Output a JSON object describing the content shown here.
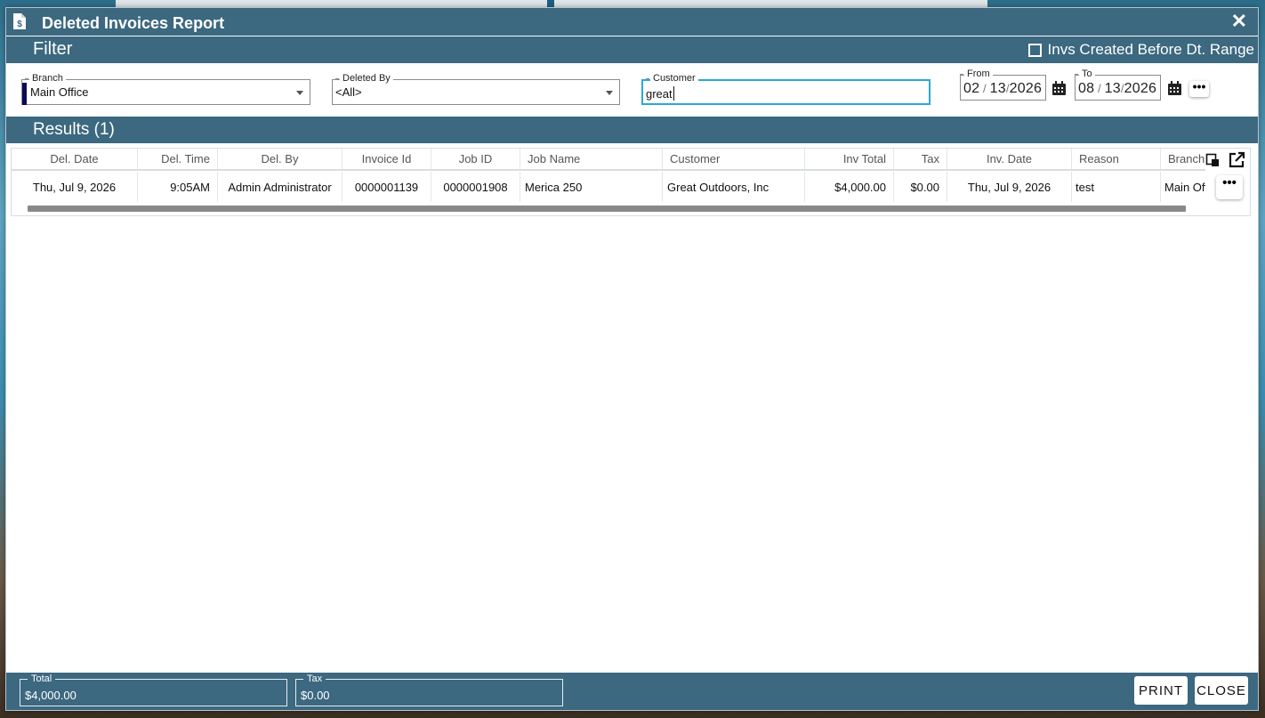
{
  "window": {
    "title": "Deleted Invoices Report",
    "close_glyph": "✕"
  },
  "filter": {
    "title": "Filter",
    "checkbox_label": "Invs Created Before Dt. Range",
    "branch": {
      "label": "Branch",
      "value": "Main Office"
    },
    "deleted_by": {
      "label": "Deleted By",
      "value": "<All>"
    },
    "customer": {
      "label": "Customer",
      "value": "great"
    },
    "from": {
      "label": "From",
      "month": "02",
      "day": "13",
      "year": "2026"
    },
    "to": {
      "label": "To",
      "month": "08",
      "day": "13",
      "year": "2026"
    },
    "more_glyph": "•••"
  },
  "results": {
    "title": "Results (1)",
    "columns": [
      "Del. Date",
      "Del. Time",
      "Del. By",
      "Invoice Id",
      "Job ID",
      "Job Name",
      "Customer",
      "Inv Total",
      "Tax",
      "Inv. Date",
      "Reason",
      "Branch"
    ],
    "rows": [
      [
        "Thu, Jul 9, 2026",
        "9:05AM",
        "Admin Administrator",
        "0000001139",
        "0000001908",
        "Merica 250",
        "Great Outdoors, Inc",
        "$4,000.00",
        "$0.00",
        "Thu, Jul 9, 2026",
        "test",
        "Main Office"
      ]
    ],
    "row_more_glyph": "•••"
  },
  "footer": {
    "total": {
      "label": "Total",
      "value": "$4,000.00"
    },
    "tax": {
      "label": "Tax",
      "value": "$0.00"
    },
    "print_label": "PRINT",
    "close_label": "CLOSE"
  },
  "icons": {
    "title": "invoice-dollar-icon",
    "calendar": "calendar-icon",
    "copy": "copy-icon",
    "export": "external-link-icon"
  },
  "colors": {
    "header": "#3c6880",
    "focus": "#29a8dc",
    "branch_accent": "#0a0a55"
  }
}
